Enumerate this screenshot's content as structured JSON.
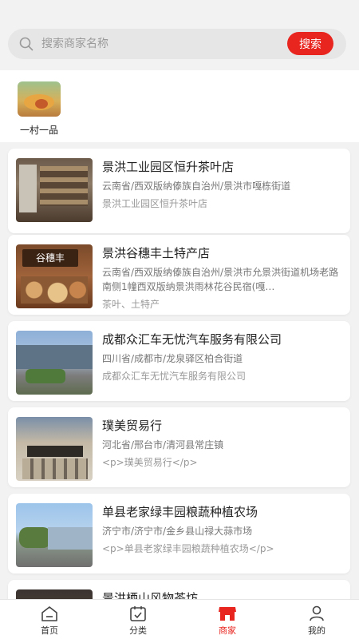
{
  "search": {
    "placeholder": "搜索商家名称",
    "button_label": "搜索"
  },
  "categories": [
    {
      "label": "一村一品",
      "icon": "produce-basket-image"
    }
  ],
  "merchants": [
    {
      "name": "景洪工业园区恒升茶叶店",
      "address": "云南省/西双版纳傣族自治州/景洪市嘎栋街道",
      "description": "景洪工业园区恒升茶叶店"
    },
    {
      "name": "景洪谷穗丰土特产店",
      "address": "云南省/西双版纳傣族自治州/景洪市允景洪街道机场老路南侧1幢西双版纳景洪雨林花谷民宿(嘎…",
      "description": "茶叶、土特产",
      "sign_text": "谷穗丰"
    },
    {
      "name": "成都众汇车无忧汽车服务有限公司",
      "address": "四川省/成都市/龙泉驿区柏合街道",
      "description": "成都众汇车无忧汽车服务有限公司"
    },
    {
      "name": "璞美贸易行",
      "address": "河北省/邢台市/清河县常庄镇",
      "description": "<p>璞美贸易行</p>"
    },
    {
      "name": "单县老家绿丰园粮蔬种植农场",
      "address": "济宁市/济宁市/金乡县山禄大蒜市场",
      "description": "<p>单县老家绿丰园粮蔬种植农场</p>"
    },
    {
      "name": "景洪栖山风物茶坊",
      "address": "",
      "description": ""
    }
  ],
  "tabbar": {
    "items": [
      {
        "label": "首页",
        "icon": "home-icon",
        "active": false
      },
      {
        "label": "分类",
        "icon": "calendar-icon",
        "active": false
      },
      {
        "label": "商家",
        "icon": "store-icon",
        "active": true
      },
      {
        "label": "我的",
        "icon": "user-icon",
        "active": false
      }
    ]
  },
  "colors": {
    "accent": "#e8251f",
    "background": "#f2f2f2",
    "card": "#ffffff"
  }
}
